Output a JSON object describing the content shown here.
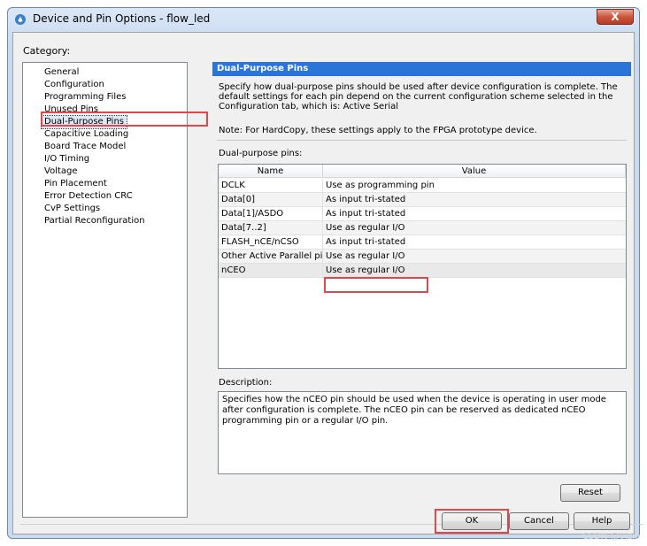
{
  "window": {
    "title": "Device and Pin Options - flow_led",
    "close_label": "X"
  },
  "category": {
    "label": "Category:",
    "items": [
      "General",
      "Configuration",
      "Programming Files",
      "Unused Pins",
      "Dual-Purpose Pins",
      "Capacitive Loading",
      "Board Trace Model",
      "I/O Timing",
      "Voltage",
      "Pin Placement",
      "Error Detection CRC",
      "CvP Settings",
      "Partial Reconfiguration"
    ],
    "selected": "Dual-Purpose Pins"
  },
  "panel": {
    "title": "Dual-Purpose Pins",
    "description": "Specify how dual-purpose pins should be used after device configuration is complete. The default settings for each pin depend on the current configuration scheme selected in the Configuration tab, which is:  Active Serial",
    "note": "Note: For HardCopy, these settings apply to the FPGA prototype device.",
    "pins_label": "Dual-purpose pins:",
    "columns": [
      "Name",
      "Value"
    ],
    "rows": [
      {
        "name": "DCLK",
        "value": "Use as programming pin"
      },
      {
        "name": "Data[0]",
        "value": "As input tri-stated"
      },
      {
        "name": "Data[1]/ASDO",
        "value": "As input tri-stated"
      },
      {
        "name": "Data[7..2]",
        "value": "Use as regular I/O"
      },
      {
        "name": "FLASH_nCE/nCSO",
        "value": "As input tri-stated"
      },
      {
        "name": "Other Active Parallel pins",
        "value": "Use as regular I/O"
      },
      {
        "name": "nCEO",
        "value": "Use as regular I/O"
      }
    ],
    "desc_label": "Description:",
    "desc_text": "Specifies how the nCEO pin should be used when the device is operating in user mode after configuration is complete. The nCEO pin can be reserved as dedicated nCEO programming pin or a regular I/O pin.",
    "reset_label": "Reset"
  },
  "buttons": {
    "ok": "OK",
    "cancel": "Cancel",
    "help": "Help"
  },
  "watermark": "CSDN @Vizio",
  "colors": {
    "section_title_bg": "#2b74d8",
    "highlight": "#e0484c"
  }
}
